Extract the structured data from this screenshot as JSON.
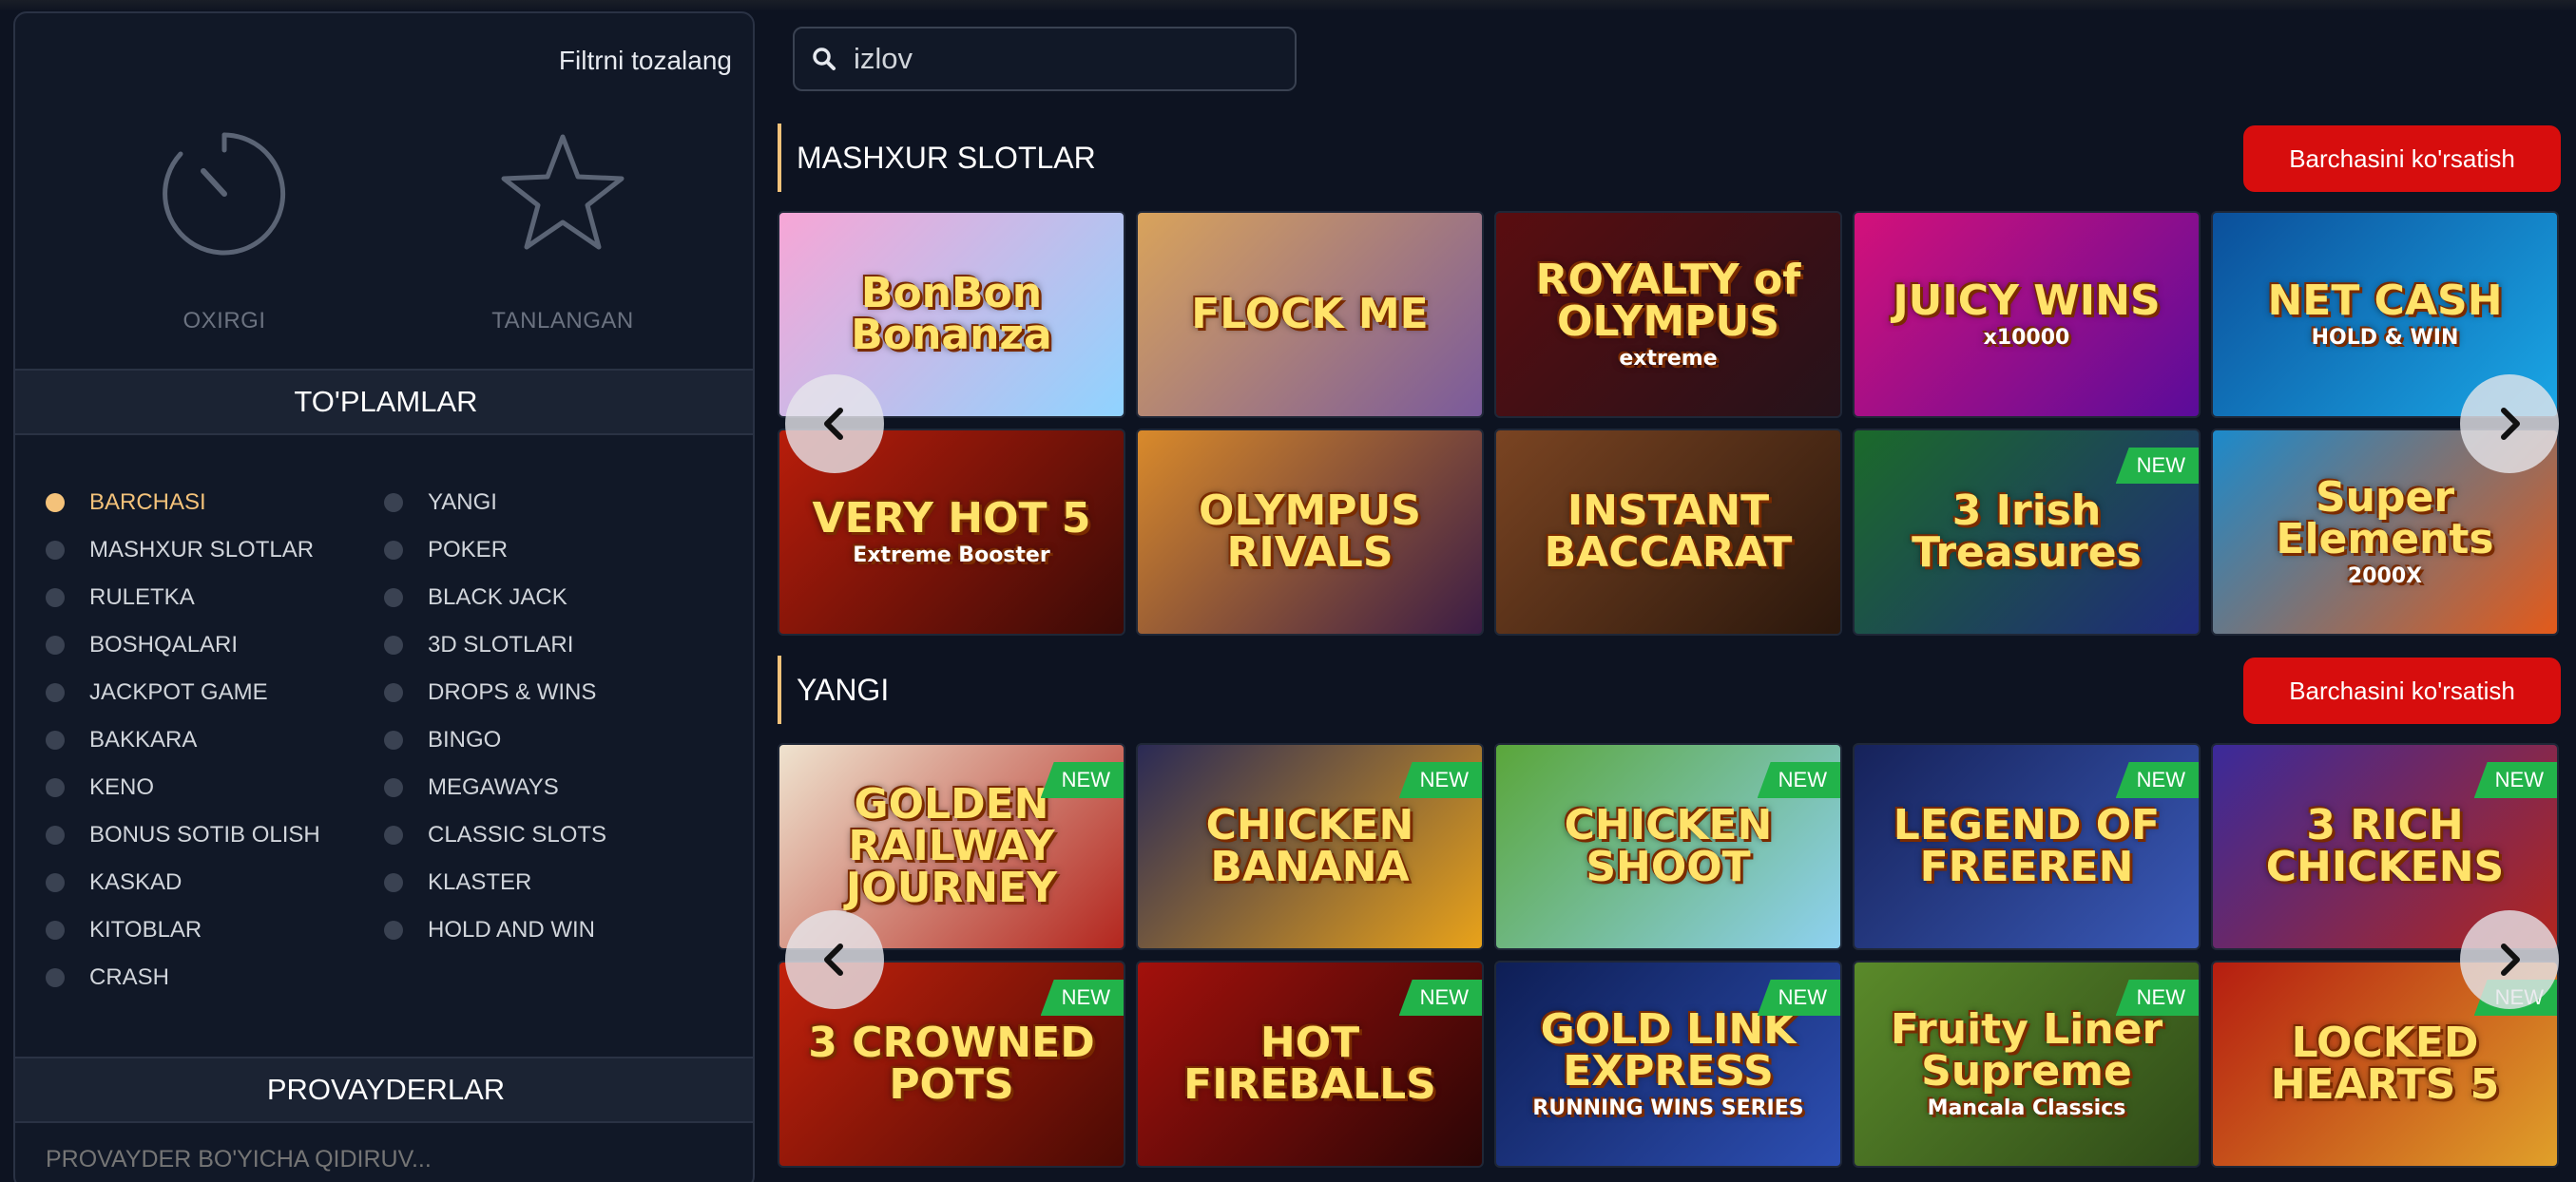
{
  "sidebar": {
    "clear_filter": "Filtrni tozalang",
    "quick_filters": [
      {
        "label": "OXIRGI",
        "icon": "timer-icon"
      },
      {
        "label": "TANLANGAN",
        "icon": "star-icon"
      }
    ],
    "collections_title": "TO'PLAMLAR",
    "collections_col1": [
      "BARCHASI",
      "MASHXUR SLOTLAR",
      "RULETKA",
      "BOSHQALARI",
      "JACKPOT GAME",
      "BAKKARA",
      "KENO",
      "BONUS SOTIB OLISH",
      "KASKAD",
      "KITOBLAR",
      "CRASH"
    ],
    "collections_col2": [
      "YANGI",
      "POKER",
      "BLACK JACK",
      "3D SLOTLARI",
      "DROPS & WINS",
      "BINGO",
      "MEGAWAYS",
      "CLASSIC SLOTS",
      "KLASTER",
      "HOLD AND WIN"
    ],
    "active_collection": "BARCHASI",
    "providers_title": "PROVAYDERLAR",
    "provider_search_placeholder": "PROVAYDER BO'YICHA QIDIRUV..."
  },
  "search": {
    "value": "izlov"
  },
  "sections": [
    {
      "title": "MASHXUR SLOTLAR",
      "see_all": "Barchasini ko'rsatish",
      "games": [
        {
          "title": "BonBon Bonanza",
          "sub": ""
        },
        {
          "title": "FLOCK ME",
          "sub": ""
        },
        {
          "title": "ROYALTY of OLYMPUS",
          "sub": "extreme"
        },
        {
          "title": "JUICY WINS",
          "sub": "x10000"
        },
        {
          "title": "NET CASH",
          "sub": "HOLD & WIN"
        },
        {
          "title": "VERY HOT 5",
          "sub": "Extreme Booster"
        },
        {
          "title": "OLYMPUS RIVALS",
          "sub": ""
        },
        {
          "title": "INSTANT BACCARAT",
          "sub": ""
        },
        {
          "title": "3 Irish Treasures",
          "sub": "",
          "badge": "NEW"
        },
        {
          "title": "Super Elements",
          "sub": "2000X"
        }
      ]
    },
    {
      "title": "YANGI",
      "see_all": "Barchasini ko'rsatish",
      "games": [
        {
          "title": "GOLDEN RAILWAY JOURNEY",
          "sub": "",
          "badge": "NEW"
        },
        {
          "title": "CHICKEN BANANA",
          "sub": "",
          "badge": "NEW"
        },
        {
          "title": "CHICKEN SHOOT",
          "sub": "",
          "badge": "NEW"
        },
        {
          "title": "LEGEND OF FREEREN",
          "sub": "",
          "badge": "NEW"
        },
        {
          "title": "3 RICH CHICKENS",
          "sub": "",
          "badge": "NEW"
        },
        {
          "title": "3 CROWNED POTS",
          "sub": "",
          "badge": "NEW"
        },
        {
          "title": "HOT FIREBALLS",
          "sub": "",
          "badge": "NEW"
        },
        {
          "title": "GOLD LINK EXPRESS",
          "sub": "RUNNING WINS SERIES",
          "badge": "NEW"
        },
        {
          "title": "Fruity Liner Supreme",
          "sub": "Mancala Classics",
          "badge": "NEW"
        },
        {
          "title": "LOCKED HEARTS 5",
          "sub": "",
          "badge": "NEW"
        }
      ]
    }
  ],
  "tile_colors": [
    [
      "#f7a6d6",
      "#8fd3ff"
    ],
    [
      "#d9a35b",
      "#7a5a9b"
    ],
    [
      "#5a0d10",
      "#24121a"
    ],
    [
      "#d4117a",
      "#5a0c9a"
    ],
    [
      "#0b4f9a",
      "#1aa7e6"
    ],
    [
      "#b81d0b",
      "#3a0a06"
    ],
    [
      "#d98a2b",
      "#3b1c45"
    ],
    [
      "#7a4422",
      "#2a170c"
    ],
    [
      "#1b6a2a",
      "#1f2a7a"
    ],
    [
      "#1c8acb",
      "#e35a1a"
    ],
    [
      "#efe3cf",
      "#b3261e"
    ],
    [
      "#2a2a55",
      "#e8a21a"
    ],
    [
      "#5aa63a",
      "#8ed1f0"
    ],
    [
      "#16225a",
      "#3a5ab8"
    ],
    [
      "#3a2a9a",
      "#b3261e"
    ],
    [
      "#c2210c",
      "#4a0a04"
    ],
    [
      "#a3110c",
      "#2a0505"
    ],
    [
      "#0e1e55",
      "#2d4fb3"
    ],
    [
      "#5a8a2a",
      "#2f4a18"
    ],
    [
      "#b51d10",
      "#e0a02a"
    ]
  ]
}
